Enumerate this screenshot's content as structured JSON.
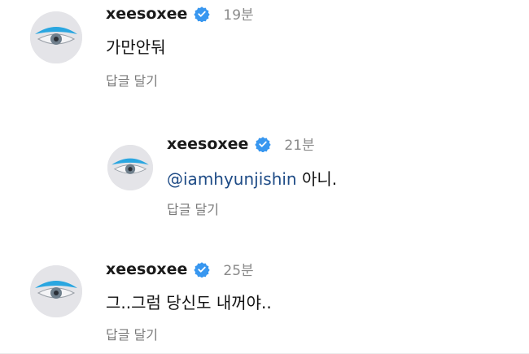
{
  "comments": [
    {
      "username": "xeesoxee",
      "time": "19분",
      "text": "가만안둬",
      "reply_label": "답글 달기",
      "avatar_icon": "eye-avatar",
      "verified_icon": "verified-badge-icon"
    },
    {
      "username": "xeesoxee",
      "time": "21분",
      "mention": "@iamhyunjishin",
      "text": " 아니.",
      "reply_label": "답글 달기",
      "avatar_icon": "eye-avatar",
      "verified_icon": "verified-badge-icon"
    },
    {
      "username": "xeesoxee",
      "time": "25분",
      "text": "그..그럼 당신도 내꺼야..",
      "reply_label": "답글 달기",
      "avatar_icon": "eye-avatar",
      "verified_icon": "verified-badge-icon"
    }
  ],
  "colors": {
    "verified": "#3897f0",
    "mention": "#1e4b86",
    "secondary_text": "#8a8a8a"
  }
}
